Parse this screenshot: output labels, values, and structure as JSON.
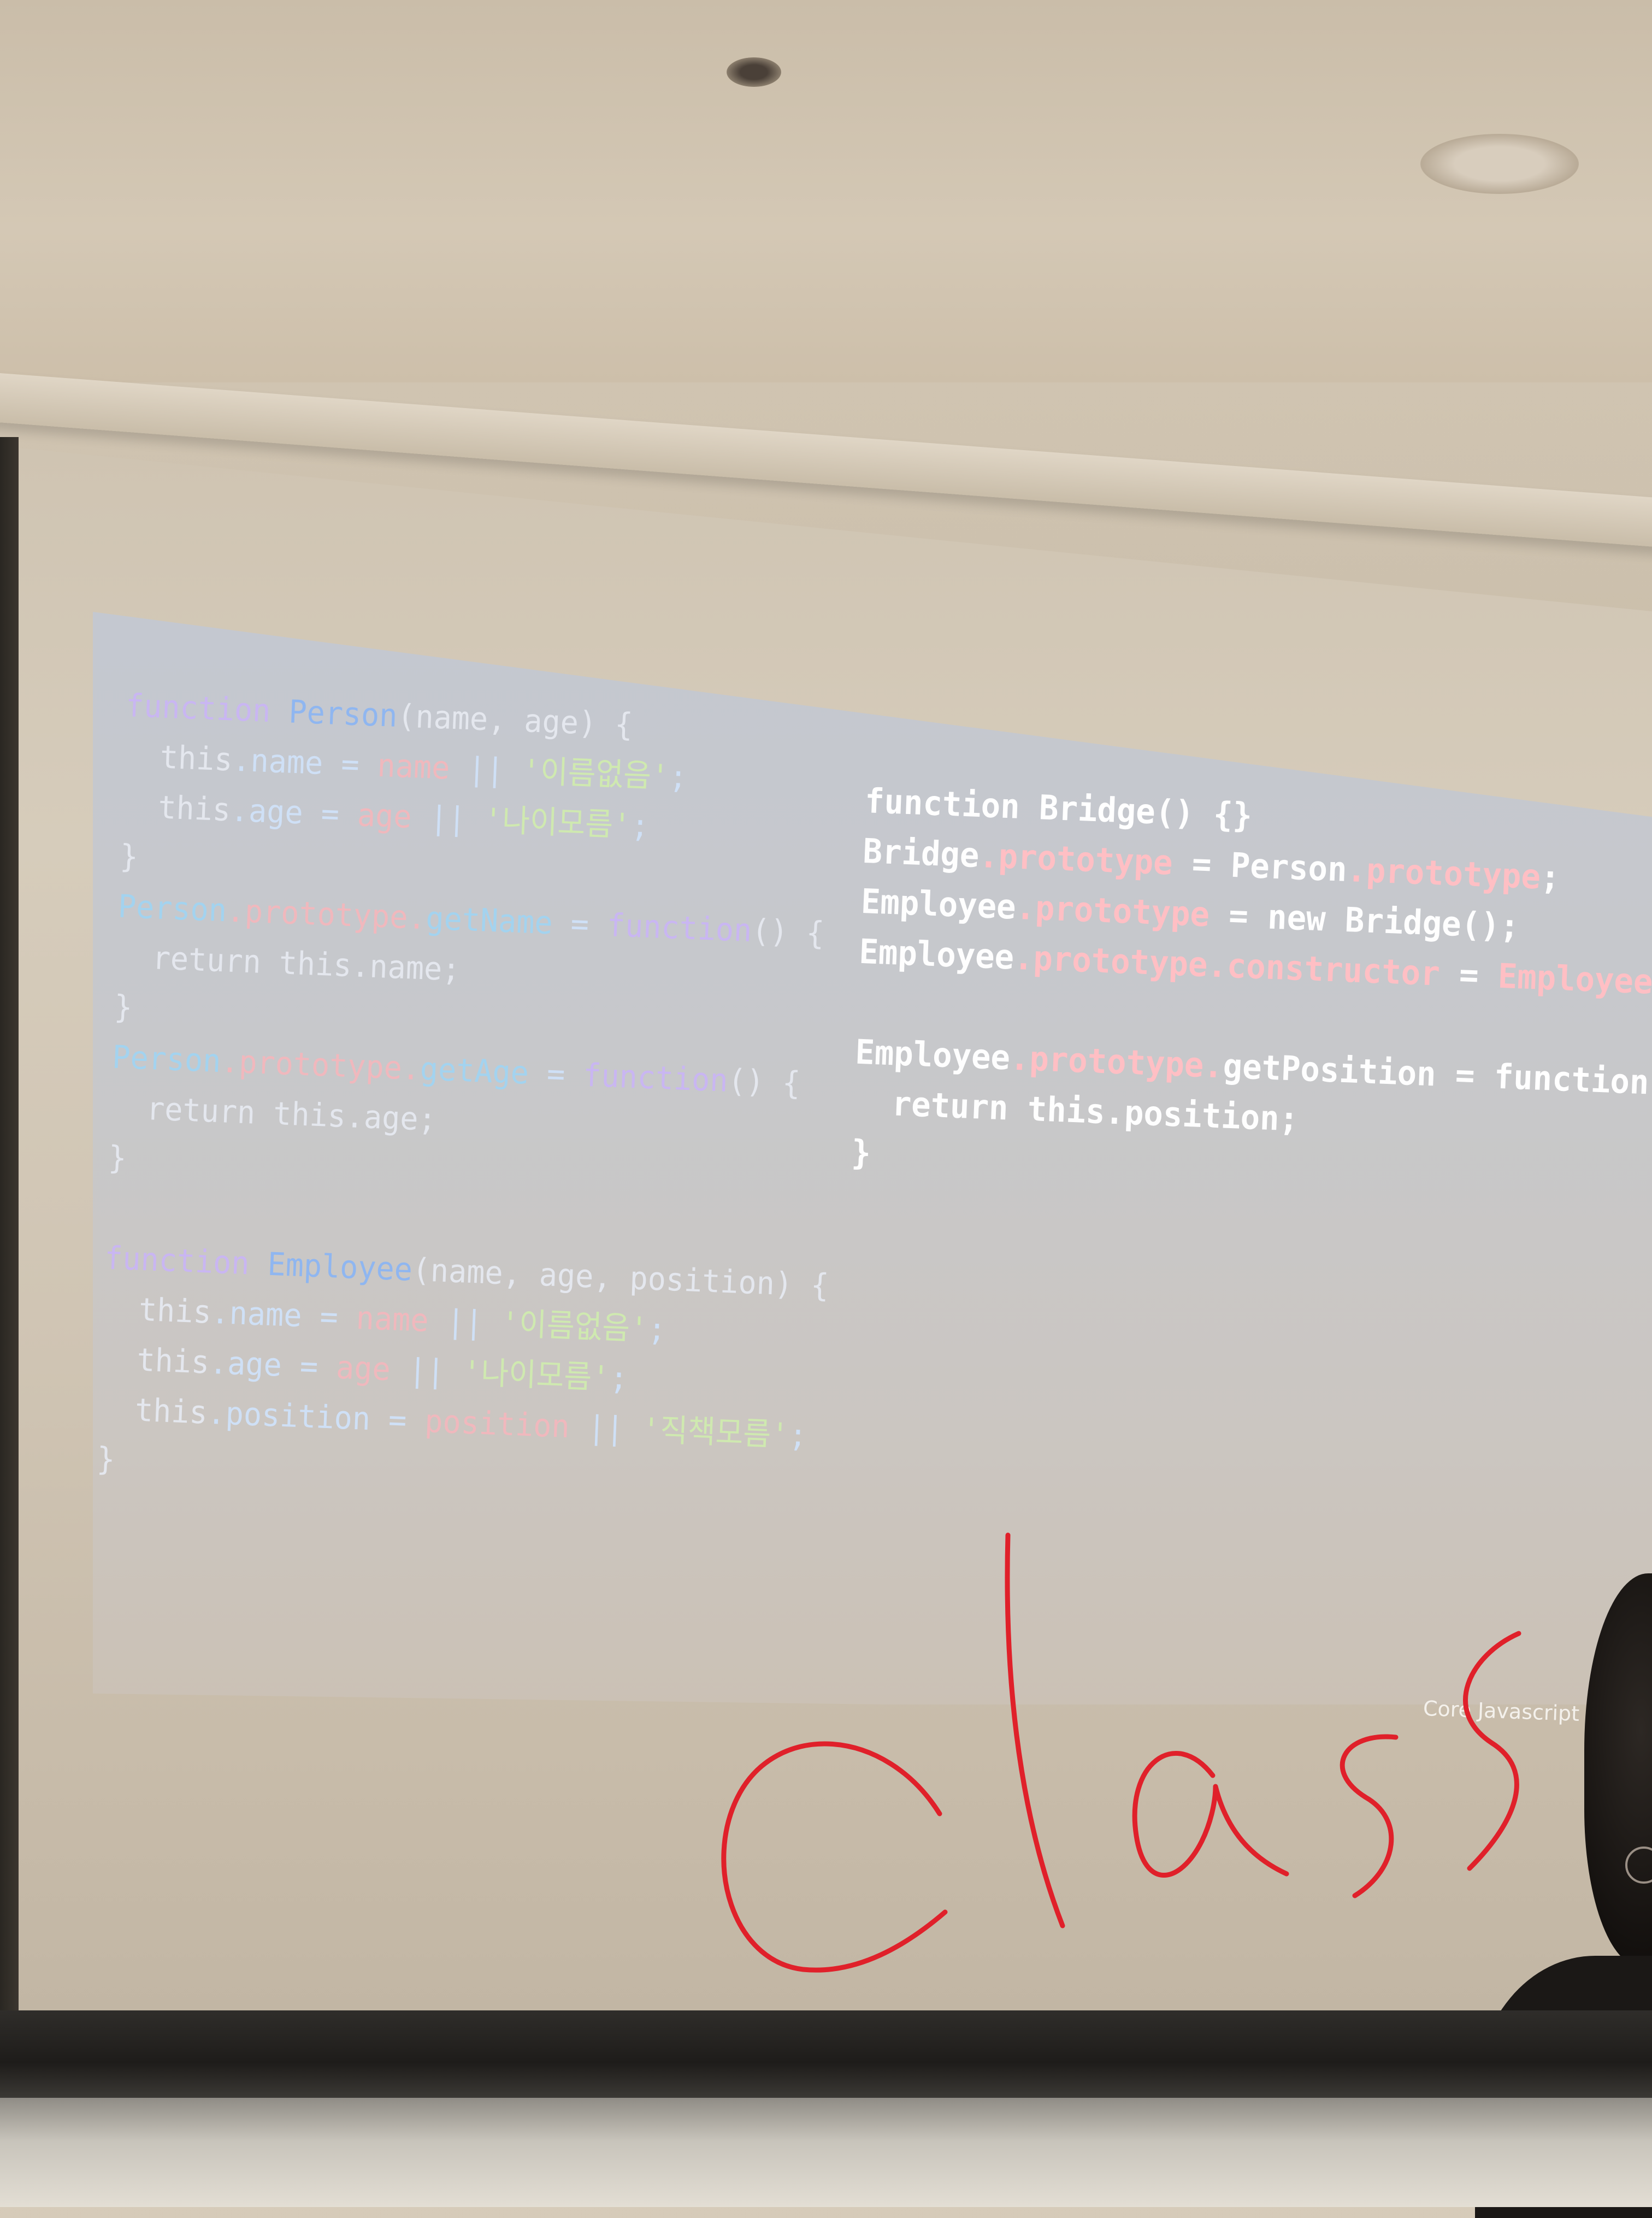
{
  "slide": {
    "code_left": {
      "lines": [
        [
          [
            "function ",
            "kw"
          ],
          [
            "Person",
            "fn"
          ],
          [
            "(name, age) {",
            "tx"
          ]
        ],
        [
          [
            "  this",
            "tx"
          ],
          [
            ".name = ",
            "op"
          ],
          [
            "name",
            "pr"
          ],
          [
            " || ",
            "op"
          ],
          [
            "'이름없음'",
            "st"
          ],
          [
            ";",
            "op"
          ]
        ],
        [
          [
            "  this",
            "tx"
          ],
          [
            ".age = ",
            "op"
          ],
          [
            "age",
            "pr"
          ],
          [
            " || ",
            "op"
          ],
          [
            "'나이모름'",
            "st"
          ],
          [
            ";",
            "op"
          ]
        ],
        [
          [
            "}",
            "tx"
          ]
        ],
        [
          [
            "Person",
            "id"
          ],
          [
            ".prototype.",
            "pr"
          ],
          [
            "getName",
            "id"
          ],
          [
            " = ",
            "op"
          ],
          [
            "function",
            "kw"
          ],
          [
            "() {",
            "tx"
          ]
        ],
        [
          [
            "  return ",
            "tx"
          ],
          [
            "this",
            "tx"
          ],
          [
            ".name;",
            "tx"
          ]
        ],
        [
          [
            "}",
            "tx"
          ]
        ],
        [
          [
            "Person",
            "id"
          ],
          [
            ".prototype.",
            "pr"
          ],
          [
            "getAge",
            "id"
          ],
          [
            " = ",
            "op"
          ],
          [
            "function",
            "kw"
          ],
          [
            "() {",
            "tx"
          ]
        ],
        [
          [
            "  return ",
            "tx"
          ],
          [
            "this",
            "tx"
          ],
          [
            ".age;",
            "tx"
          ]
        ],
        [
          [
            "}",
            "tx"
          ]
        ],
        [],
        [
          [
            "function ",
            "kw"
          ],
          [
            "Employee",
            "fn"
          ],
          [
            "(name, age, position) {",
            "tx"
          ]
        ],
        [
          [
            "  this",
            "tx"
          ],
          [
            ".name = ",
            "op"
          ],
          [
            "name",
            "pr"
          ],
          [
            " || ",
            "op"
          ],
          [
            "'이름없음'",
            "st"
          ],
          [
            ";",
            "op"
          ]
        ],
        [
          [
            "  this",
            "tx"
          ],
          [
            ".age = ",
            "op"
          ],
          [
            "age",
            "pr"
          ],
          [
            " || ",
            "op"
          ],
          [
            "'나이모름'",
            "st"
          ],
          [
            ";",
            "op"
          ]
        ],
        [
          [
            "  this",
            "tx"
          ],
          [
            ".position = ",
            "op"
          ],
          [
            "position",
            "pr"
          ],
          [
            " || ",
            "op"
          ],
          [
            "'직책모름'",
            "st"
          ],
          [
            ";",
            "op"
          ]
        ],
        [
          [
            "}",
            "tx"
          ]
        ]
      ]
    },
    "code_right": {
      "lines": [
        [
          [
            "function ",
            "kw"
          ],
          [
            "Bridge",
            "fn"
          ],
          [
            "() {}",
            "tx"
          ]
        ],
        [
          [
            "Bridge",
            "tx"
          ],
          [
            ".prototype",
            "pr"
          ],
          [
            " = ",
            "tx"
          ],
          [
            "Person",
            "tx"
          ],
          [
            ".prototype",
            "pr"
          ],
          [
            ";",
            "tx"
          ]
        ],
        [
          [
            "Employee",
            "tx"
          ],
          [
            ".prototype",
            "pr"
          ],
          [
            " = ",
            "tx"
          ],
          [
            "new ",
            "kw"
          ],
          [
            "Bridge",
            "tx"
          ],
          [
            "();",
            "tx"
          ]
        ],
        [
          [
            "Employee",
            "tx"
          ],
          [
            ".prototype.constructor",
            "pr"
          ],
          [
            " = ",
            "tx"
          ],
          [
            "Employee",
            "pr"
          ],
          [
            ";",
            "tx"
          ]
        ],
        [],
        [
          [
            "Employee",
            "tx"
          ],
          [
            ".prototype.",
            "pr"
          ],
          [
            "getPosition",
            "tx"
          ],
          [
            " = ",
            "tx"
          ],
          [
            "function",
            "kw"
          ],
          [
            "(){",
            "tx"
          ]
        ],
        [
          [
            "  return ",
            "tx"
          ],
          [
            "this",
            "tx"
          ],
          [
            ".position;",
            "tx"
          ]
        ],
        [
          [
            "}",
            "tx"
          ]
        ]
      ]
    },
    "footer": "Core Javascript"
  },
  "annotation": {
    "handwriting": "class",
    "color": "#e0202a"
  },
  "colors": {
    "keyword": "#c9b6f2",
    "function_name": "#8fb6f0",
    "string": "#cfe9b0",
    "property": "#f0b8bd"
  }
}
